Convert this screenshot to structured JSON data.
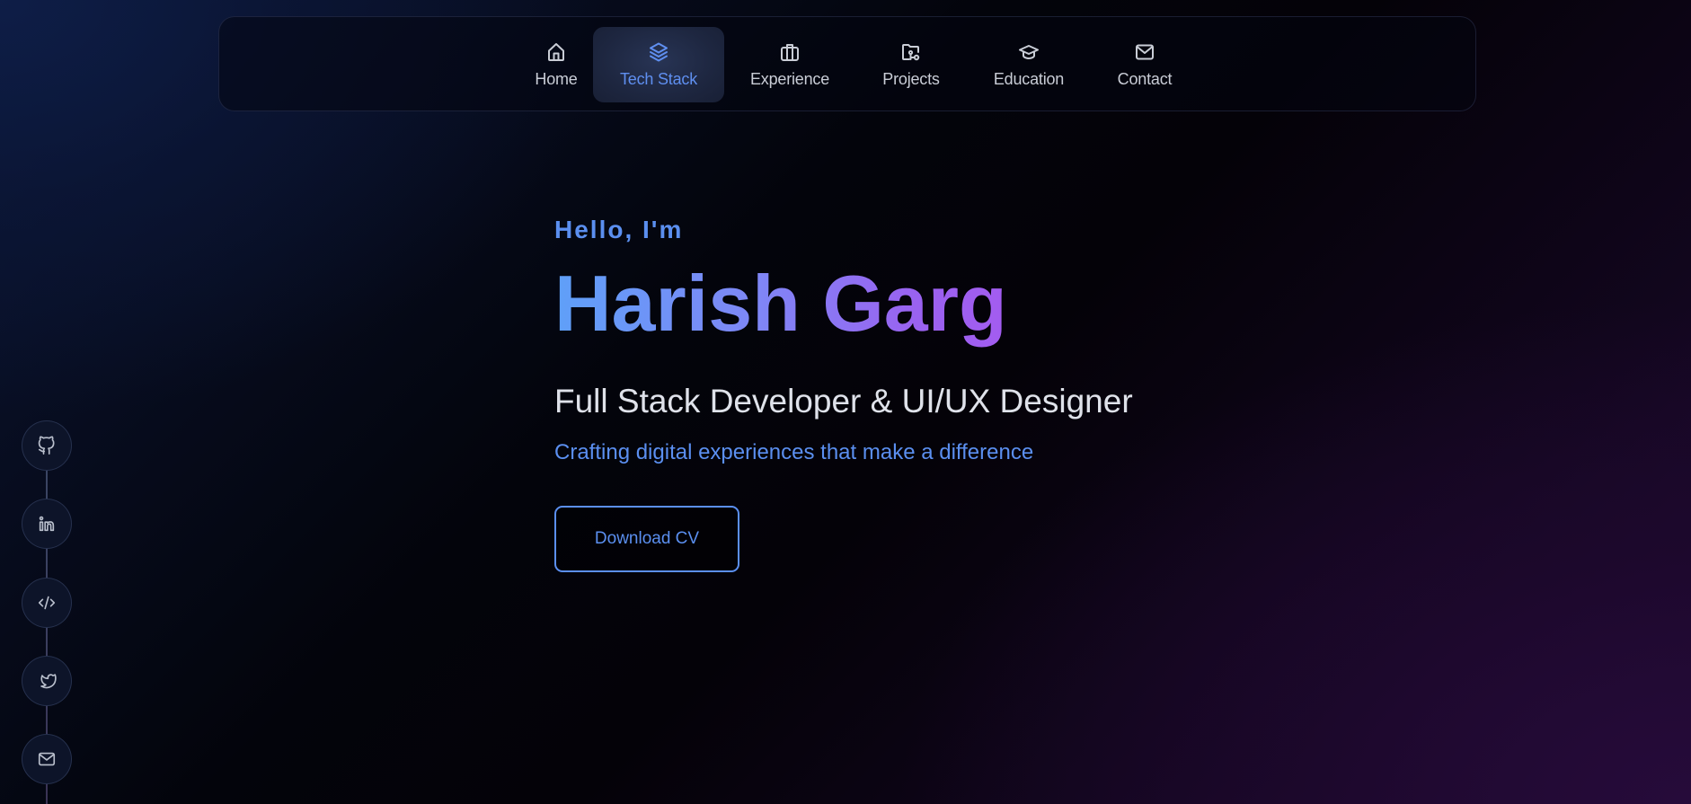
{
  "nav": {
    "items": [
      {
        "label": "Home",
        "icon": "home-icon",
        "active": false
      },
      {
        "label": "Tech Stack",
        "icon": "layers-icon",
        "active": true
      },
      {
        "label": "Experience",
        "icon": "briefcase-icon",
        "active": false
      },
      {
        "label": "Projects",
        "icon": "folder-key-icon",
        "active": false
      },
      {
        "label": "Education",
        "icon": "graduation-cap-icon",
        "active": false
      },
      {
        "label": "Contact",
        "icon": "mail-icon",
        "active": false
      }
    ]
  },
  "hero": {
    "greeting": "Hello, I'm",
    "name": "Harish Garg",
    "role": "Full Stack Developer & UI/UX Designer",
    "tagline": "Crafting digital experiences that make a difference",
    "cta_label": "Download CV"
  },
  "social": {
    "items": [
      {
        "label": "GitHub",
        "icon": "github-icon"
      },
      {
        "label": "LinkedIn",
        "icon": "linkedin-icon"
      },
      {
        "label": "Code",
        "icon": "code-icon"
      },
      {
        "label": "Twitter",
        "icon": "twitter-icon"
      },
      {
        "label": "Email",
        "icon": "mail-icon"
      }
    ]
  },
  "colors": {
    "accent": "#5b8ff0",
    "name_gradient_start": "#5fa0f8",
    "name_gradient_end": "#a35cf0",
    "nav_text": "#c9cdd6",
    "role_text": "#dfe2ea"
  }
}
